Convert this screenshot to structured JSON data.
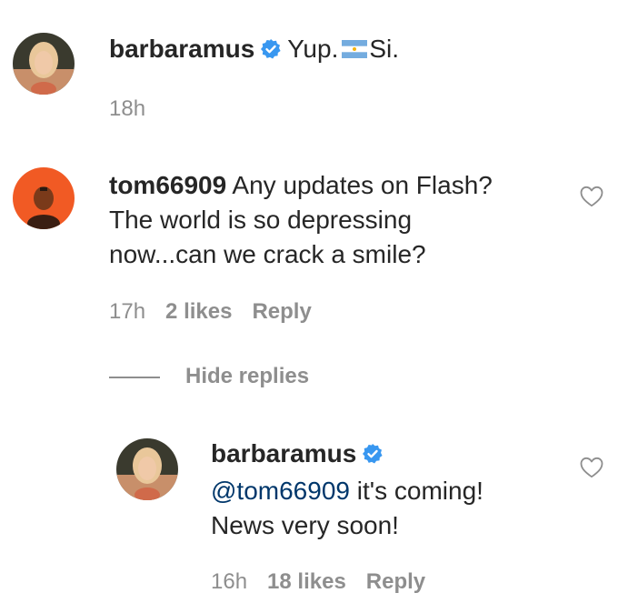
{
  "comments": [
    {
      "username": "barbaramus",
      "verified": true,
      "text_before_flag": "Yup.",
      "flag_icon": "argentina-flag-icon",
      "text_after_flag": "Si.",
      "time": "18h"
    },
    {
      "username": "tom66909",
      "verified": false,
      "text_line1": "Any updates on Flash?",
      "text_line2": "The world is so depressing",
      "text_line3": "now...can we crack a smile?",
      "time": "17h",
      "likes": "2 likes",
      "reply_label": "Reply"
    }
  ],
  "hide_replies_label": "Hide replies",
  "reply": {
    "username": "barbaramus",
    "verified": true,
    "mention": "@tom66909",
    "text_line1_rest": "it's coming!",
    "text_line2": "News very soon!",
    "time": "16h",
    "likes": "18 likes",
    "reply_label": "Reply"
  },
  "colors": {
    "verified_badge": "#3897f0",
    "mention": "#00376b",
    "meta_text": "#8e8e8e",
    "avatar_orange": "#f15a24"
  }
}
